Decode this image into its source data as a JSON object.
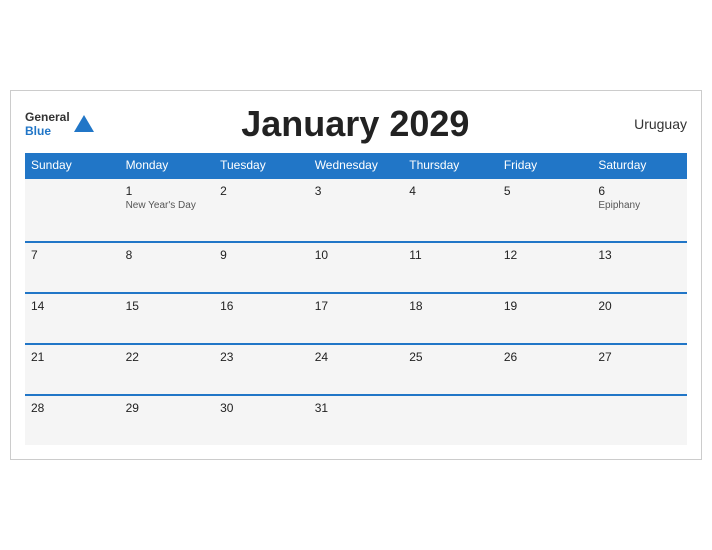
{
  "header": {
    "logo_line1": "General",
    "logo_line2": "Blue",
    "title": "January 2029",
    "country": "Uruguay"
  },
  "weekdays": [
    "Sunday",
    "Monday",
    "Tuesday",
    "Wednesday",
    "Thursday",
    "Friday",
    "Saturday"
  ],
  "weeks": [
    [
      {
        "day": "",
        "holiday": ""
      },
      {
        "day": "1",
        "holiday": "New Year's Day"
      },
      {
        "day": "2",
        "holiday": ""
      },
      {
        "day": "3",
        "holiday": ""
      },
      {
        "day": "4",
        "holiday": ""
      },
      {
        "day": "5",
        "holiday": ""
      },
      {
        "day": "6",
        "holiday": "Epiphany"
      }
    ],
    [
      {
        "day": "7",
        "holiday": ""
      },
      {
        "day": "8",
        "holiday": ""
      },
      {
        "day": "9",
        "holiday": ""
      },
      {
        "day": "10",
        "holiday": ""
      },
      {
        "day": "11",
        "holiday": ""
      },
      {
        "day": "12",
        "holiday": ""
      },
      {
        "day": "13",
        "holiday": ""
      }
    ],
    [
      {
        "day": "14",
        "holiday": ""
      },
      {
        "day": "15",
        "holiday": ""
      },
      {
        "day": "16",
        "holiday": ""
      },
      {
        "day": "17",
        "holiday": ""
      },
      {
        "day": "18",
        "holiday": ""
      },
      {
        "day": "19",
        "holiday": ""
      },
      {
        "day": "20",
        "holiday": ""
      }
    ],
    [
      {
        "day": "21",
        "holiday": ""
      },
      {
        "day": "22",
        "holiday": ""
      },
      {
        "day": "23",
        "holiday": ""
      },
      {
        "day": "24",
        "holiday": ""
      },
      {
        "day": "25",
        "holiday": ""
      },
      {
        "day": "26",
        "holiday": ""
      },
      {
        "day": "27",
        "holiday": ""
      }
    ],
    [
      {
        "day": "28",
        "holiday": ""
      },
      {
        "day": "29",
        "holiday": ""
      },
      {
        "day": "30",
        "holiday": ""
      },
      {
        "day": "31",
        "holiday": ""
      },
      {
        "day": "",
        "holiday": ""
      },
      {
        "day": "",
        "holiday": ""
      },
      {
        "day": "",
        "holiday": ""
      }
    ]
  ]
}
